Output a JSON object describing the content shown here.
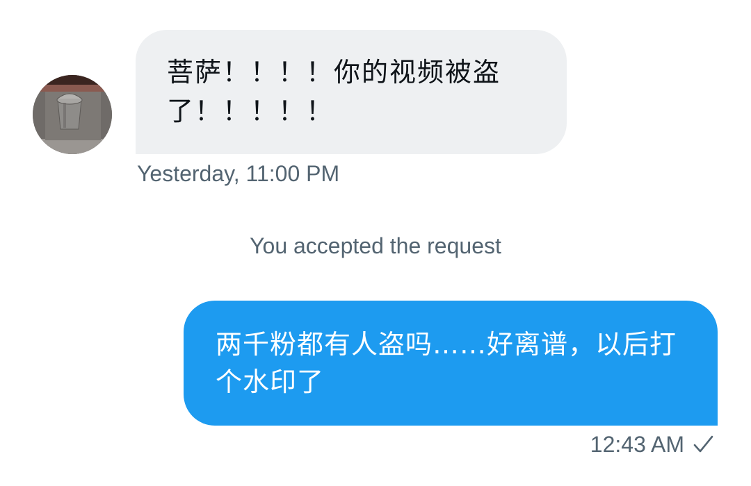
{
  "conversation": {
    "incoming": {
      "avatar_icon": "trash-can-photo-avatar",
      "text": "菩萨！！！！你的视频被盗了！！！！！",
      "timestamp": "Yesterday, 11:00 PM"
    },
    "system_note": "You accepted the request",
    "outgoing": {
      "text": "两千粉都有人盗吗……好离谱，以后打个水印了",
      "timestamp": "12:43 AM",
      "status_icon": "checkmark-icon"
    }
  },
  "colors": {
    "incoming_bubble": "#eef0f2",
    "outgoing_bubble": "#1d9bf0",
    "secondary_text": "#536471",
    "primary_text": "#0f1419"
  }
}
